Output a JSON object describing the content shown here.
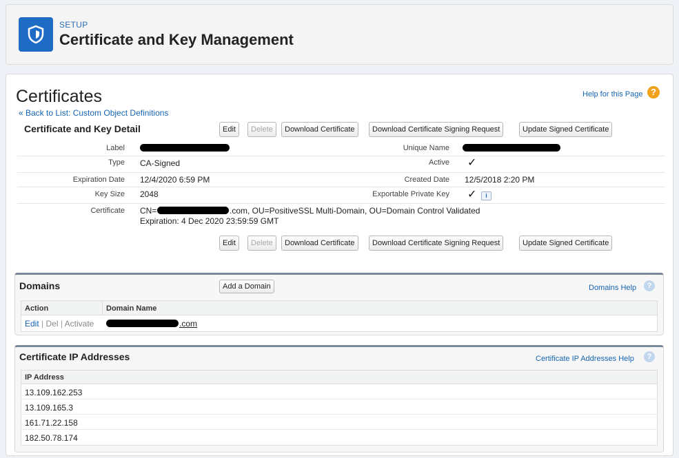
{
  "header": {
    "setup_label": "SETUP",
    "title": "Certificate and Key Management",
    "icon": "shield-icon"
  },
  "page": {
    "title": "Certificates",
    "help_link": "Help for this Page",
    "back_link": "« Back to List: Custom Object Definitions"
  },
  "detail": {
    "section_title": "Certificate and Key Detail",
    "buttons": {
      "edit": "Edit",
      "delete": "Delete",
      "download_certificate": "Download Certificate",
      "download_csr": "Download Certificate Signing Request",
      "update_signed": "Update Signed Certificate"
    },
    "fields": {
      "label_label": "Label",
      "unique_name_label": "Unique Name",
      "type_label": "Type",
      "type_value": "CA-Signed",
      "active_label": "Active",
      "expiration_label": "Expiration Date",
      "expiration_value": "12/4/2020 6:59 PM",
      "created_label": "Created Date",
      "created_value": "12/5/2018 2:20 PM",
      "key_size_label": "Key Size",
      "key_size_value": "2048",
      "exportable_label": "Exportable Private Key",
      "certificate_label": "Certificate",
      "certificate_prefix": "CN=",
      "certificate_suffix": ".com, OU=PositiveSSL Multi-Domain, OU=Domain Control Validated",
      "certificate_expiration": "Expiration: 4 Dec 2020 23:59:59 GMT"
    },
    "check_glyph": "✓",
    "info_glyph": "i"
  },
  "domains": {
    "title": "Domains",
    "add_button": "Add a Domain",
    "help_link": "Domains Help",
    "columns": [
      "Action",
      "Domain Name"
    ],
    "row": {
      "edit": "Edit",
      "del": "Del",
      "activate": "Activate",
      "separator": "|",
      "domain_suffix": ".com"
    }
  },
  "ip_addresses": {
    "title": "Certificate IP Addresses",
    "help_link": "Certificate IP Addresses Help",
    "column": "IP Address",
    "rows": [
      "13.109.162.253",
      "13.109.165.3",
      "161.71.22.158",
      "182.50.78.174"
    ]
  },
  "colors": {
    "brand_blue": "#1f6cc7",
    "link_blue": "#1564b2",
    "help_orange": "#f0a21b"
  }
}
